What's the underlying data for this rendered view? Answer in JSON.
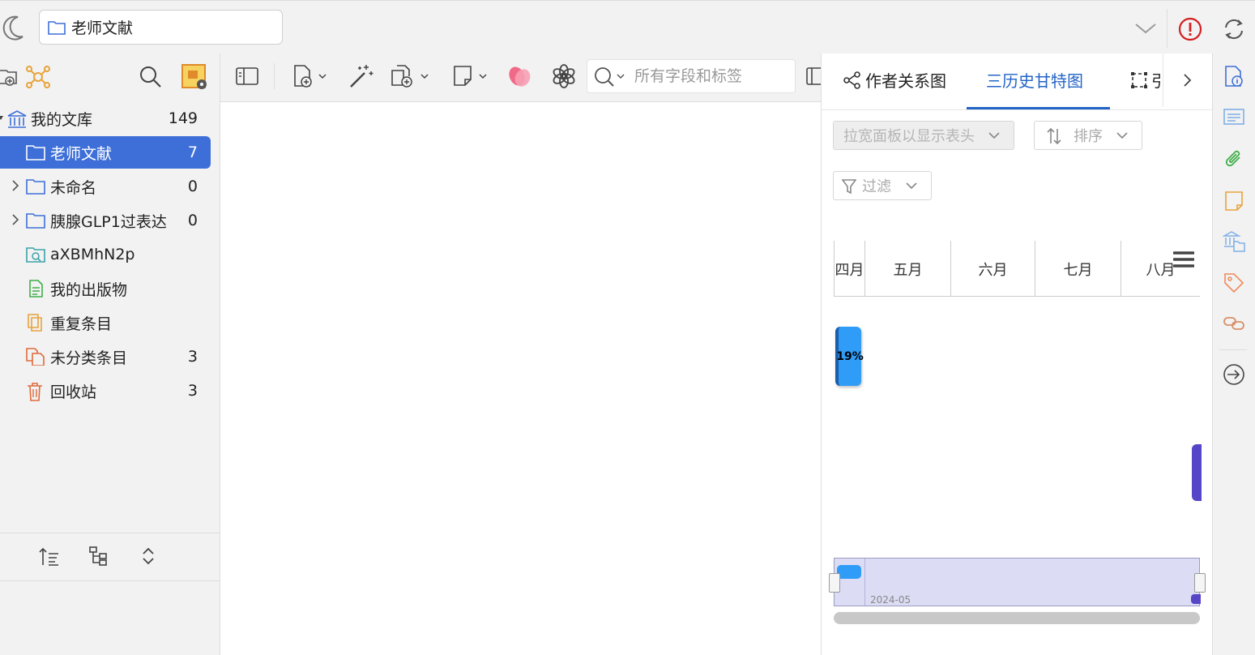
{
  "topbar": {
    "tab_title": "老师文献",
    "icons": [
      "moon-icon",
      "folder-icon",
      "chevron-down-icon",
      "alert-icon",
      "sync-icon"
    ]
  },
  "library": {
    "items": [
      {
        "label": "我的文库",
        "count": "149",
        "icon": "library-icon"
      },
      {
        "label": "老师文献",
        "count": "7",
        "icon": "folder-icon",
        "selected": true
      },
      {
        "label": "未命名",
        "count": "0",
        "icon": "folder-icon"
      },
      {
        "label": "胰腺GLP1过表达",
        "count": "0",
        "icon": "folder-icon"
      },
      {
        "label": "aXBMhN2p",
        "count": "",
        "icon": "saved-search-icon"
      },
      {
        "label": "我的出版物",
        "count": "",
        "icon": "publications-icon"
      },
      {
        "label": "重复条目",
        "count": "",
        "icon": "duplicate-icon"
      },
      {
        "label": "未分类条目",
        "count": "3",
        "icon": "unfiled-icon"
      },
      {
        "label": "回收站",
        "count": "3",
        "icon": "trash-icon"
      }
    ]
  },
  "search": {
    "placeholder": "所有字段和标签"
  },
  "right_panel": {
    "tabs": [
      {
        "label": "作者关系图",
        "icon": "graph-icon"
      },
      {
        "label": "三历史甘特图",
        "icon": ""
      },
      {
        "label": "引",
        "icon": "frame-icon"
      }
    ],
    "dropdown_columns": "拉宽面板以显示表头",
    "dropdown_sort": "排序",
    "dropdown_filter": "过滤",
    "months": [
      "四月",
      "五月",
      "六月",
      "七月",
      "八月"
    ],
    "task_progress": "19%",
    "navigator_label": "2024-05"
  },
  "colors": {
    "accent": "#3e6fd8",
    "tab_active": "#2464c7",
    "task_bar": "#2f9df7",
    "task_bar2": "#5546c8",
    "alert": "#d32020"
  }
}
